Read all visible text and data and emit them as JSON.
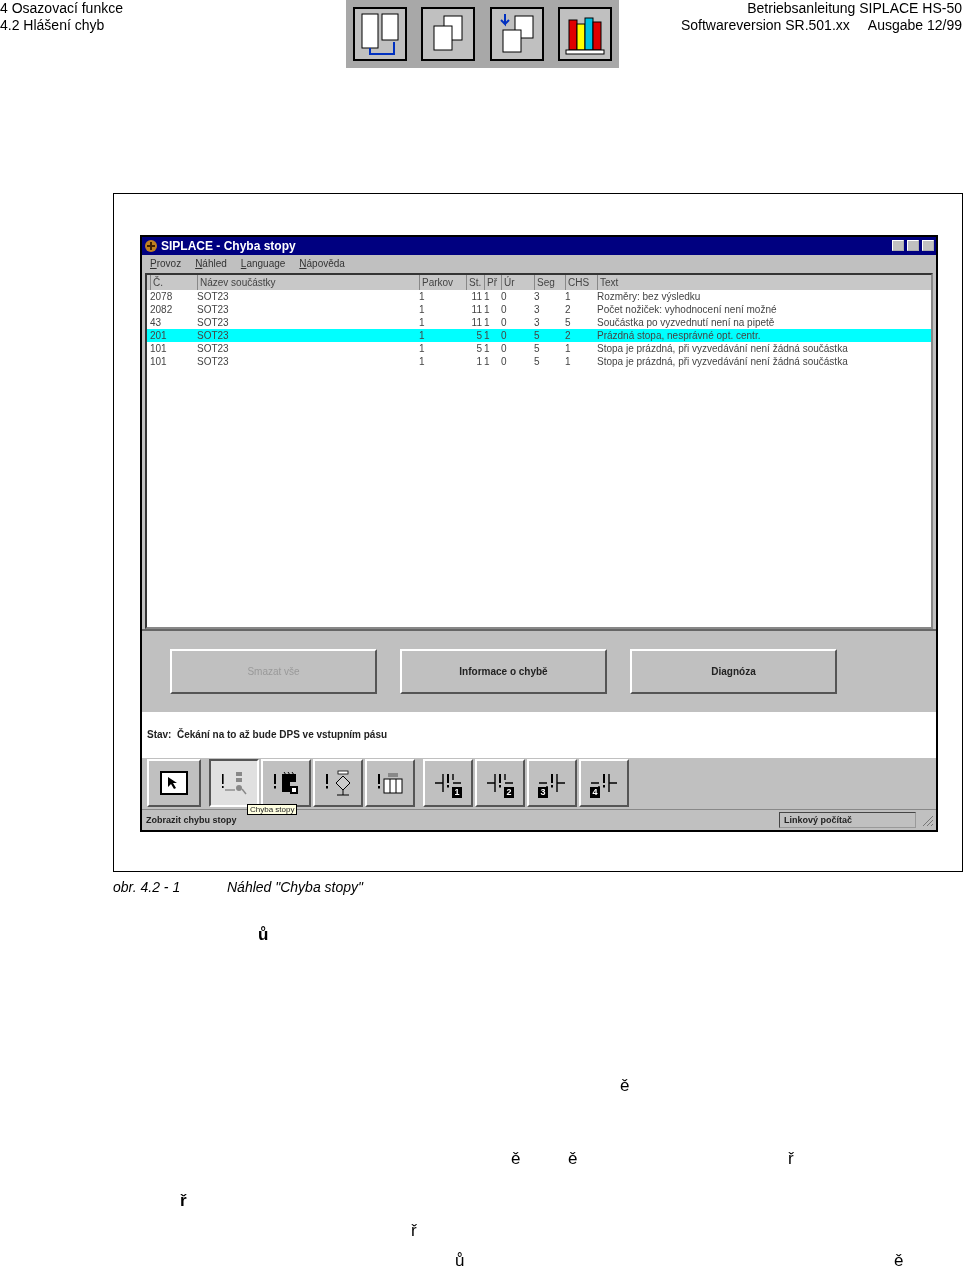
{
  "header": {
    "chapter": "4 Osazovací funkce",
    "section": "4.2 Hlášení chyb",
    "manual_title": "Betriebsanleitung SIPLACE HS-50",
    "software_version": "Softwareversion SR.501.xx",
    "edition": "Ausgabe 12/99"
  },
  "window": {
    "title": "SIPLACE - Chyba stopy",
    "menu": [
      "Provoz",
      "Náhled",
      "Language",
      "Nápověda"
    ],
    "table": {
      "columns": [
        "Č.",
        "Název součástky",
        "Parkov",
        "St.",
        "Př",
        "Úr",
        "Seg",
        "CHS",
        "Text"
      ],
      "rows": [
        {
          "cells": [
            "2078",
            "SOT23",
            "1",
            "11",
            "1",
            "0",
            "3",
            "1",
            "Rozměry: bez výsledku"
          ],
          "selected": false
        },
        {
          "cells": [
            "2082",
            "SOT23",
            "1",
            "11",
            "1",
            "0",
            "3",
            "2",
            "Počet nožiček: vyhodnocení není možné"
          ],
          "selected": false
        },
        {
          "cells": [
            "43",
            "SOT23",
            "1",
            "11",
            "1",
            "0",
            "3",
            "5",
            "Součástka po vyzvednutí není na pipetě"
          ],
          "selected": false
        },
        {
          "cells": [
            "201",
            "SOT23",
            "1",
            "5",
            "1",
            "0",
            "5",
            "2",
            "Prázdná stopa, nesprávné opt. centr."
          ],
          "selected": true
        },
        {
          "cells": [
            "101",
            "SOT23",
            "1",
            "5",
            "1",
            "0",
            "5",
            "1",
            "Stopa je prázdná, při vyzvedávání není žádná součástka"
          ],
          "selected": false
        },
        {
          "cells": [
            "101",
            "SOT23",
            "1",
            "1",
            "1",
            "0",
            "5",
            "1",
            "Stopa je prázdná, při vyzvedávání není žádná součástka"
          ],
          "selected": false
        }
      ]
    },
    "buttons": [
      {
        "label": "Smazat vše",
        "disabled": true
      },
      {
        "label": "Informace o chybě",
        "disabled": false
      },
      {
        "label": "Diagnóza",
        "disabled": false
      }
    ],
    "status": "Stav:  Čekání na to až bude DPS ve vstupním pásu",
    "toolbar": [
      {
        "kind": "cursor",
        "selected": false
      },
      {
        "kind": "list",
        "selected": true,
        "tooltip": "Chyba stopy"
      },
      {
        "kind": "chip",
        "selected": false
      },
      {
        "kind": "diamond",
        "selected": false
      },
      {
        "kind": "tray",
        "selected": false
      },
      {
        "kind": "slot-right",
        "selected": false,
        "badge": "1"
      },
      {
        "kind": "slot-right",
        "selected": false,
        "badge": "2"
      },
      {
        "kind": "slot-left",
        "selected": false,
        "badge": "3"
      },
      {
        "kind": "slot-left",
        "selected": false,
        "badge": "4"
      }
    ],
    "status_bar": [
      "Zobrazit chybu stopy",
      "Linkový počítač"
    ]
  },
  "caption": {
    "number": "obr. 4.2 - 1",
    "title": "Náhled \"Chyba stopy\""
  },
  "body_lines": [
    {
      "fragments": [
        {
          "text": "ů",
          "bold": true
        }
      ]
    },
    {
      "fragments": [
        {
          "text": "ě",
          "bold": false
        }
      ]
    },
    {
      "fragments": [
        {
          "text": "ě",
          "bold": false
        },
        {
          "text": "ě",
          "bold": false
        },
        {
          "text": "ř",
          "bold": false
        }
      ]
    },
    {
      "fragments": [
        {
          "text": "ř",
          "bold": true
        }
      ]
    },
    {
      "fragments": [
        {
          "text": "ř",
          "bold": false
        }
      ]
    },
    {
      "fragments": [
        {
          "text": "ů",
          "bold": false
        },
        {
          "text": "ě",
          "bold": false
        }
      ]
    }
  ]
}
